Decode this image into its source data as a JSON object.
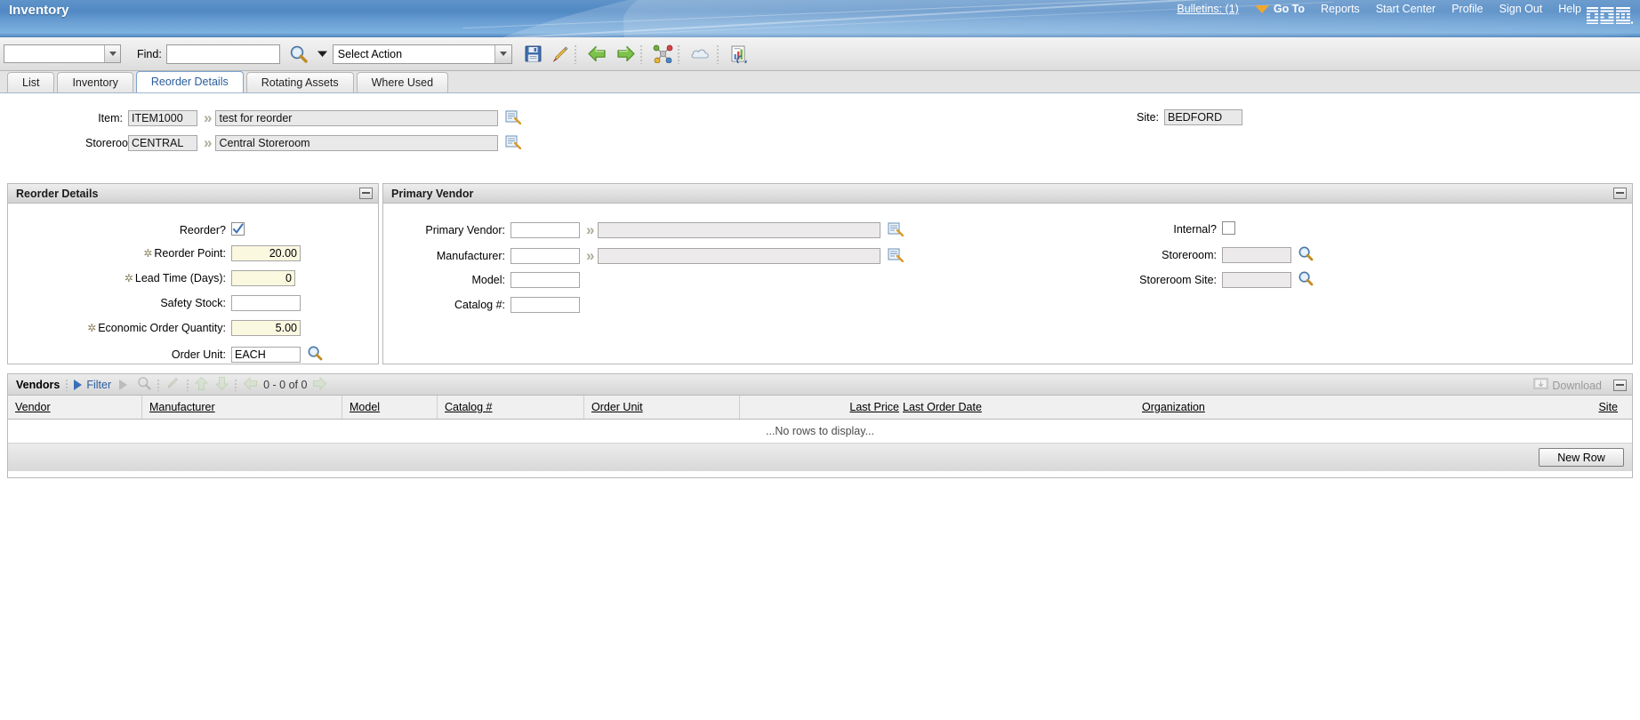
{
  "app": {
    "title": "Inventory"
  },
  "nav": {
    "bulletins": "Bulletins: (1)",
    "goto": "Go To",
    "reports": "Reports",
    "start_center": "Start Center",
    "profile": "Profile",
    "sign_out": "Sign Out",
    "help": "Help",
    "brand": "IBM"
  },
  "toolbar": {
    "search_select_value": "",
    "find_label": "Find:",
    "find_value": "",
    "action_label": "Select Action",
    "icons": [
      "save-icon",
      "clear-changes-icon",
      "previous-record-icon",
      "next-record-icon",
      "workflow-icon",
      "view-history-icon",
      "create-report-icon"
    ]
  },
  "tabs": [
    {
      "label": "List",
      "active": false
    },
    {
      "label": "Inventory",
      "active": false
    },
    {
      "label": "Reorder Details",
      "active": true
    },
    {
      "label": "Rotating Assets",
      "active": false
    },
    {
      "label": "Where Used",
      "active": false
    }
  ],
  "header_form": {
    "item_label": "Item:",
    "item_value": "ITEM1000",
    "item_desc": "test for reorder",
    "storeroom_label": "Storeroom:",
    "storeroom_value": "CENTRAL",
    "storeroom_desc": "Central Storeroom",
    "site_label": "Site:",
    "site_value": "BEDFORD"
  },
  "reorder_details": {
    "title": "Reorder Details",
    "fields": [
      {
        "label": "Reorder?",
        "value": "",
        "type": "checkbox",
        "checked": true,
        "required": false
      },
      {
        "label": "Reorder Point:",
        "value": "20.00",
        "type": "number",
        "required": true
      },
      {
        "label": "Lead Time (Days):",
        "value": "0",
        "type": "number",
        "required": true
      },
      {
        "label": "Safety Stock:",
        "value": "",
        "type": "number",
        "required": false
      },
      {
        "label": "Economic Order Quantity:",
        "value": "5.00",
        "type": "number",
        "required": true
      },
      {
        "label": "Order Unit:",
        "value": "EACH",
        "type": "lookup",
        "required": false
      }
    ]
  },
  "primary_vendor": {
    "title": "Primary Vendor",
    "left_fields": [
      {
        "label": "Primary Vendor:",
        "value": "",
        "desc": "",
        "has_chevron": true,
        "has_detail": true
      },
      {
        "label": "Manufacturer:",
        "value": "",
        "desc": "",
        "has_chevron": true,
        "has_detail": true
      },
      {
        "label": "Model:",
        "value": "",
        "has_chevron": false,
        "has_detail": false
      },
      {
        "label": "Catalog #:",
        "value": "",
        "has_chevron": false,
        "has_detail": false
      }
    ],
    "right_fields": [
      {
        "label": "Internal?",
        "value": "",
        "type": "checkbox",
        "checked": false
      },
      {
        "label": "Storeroom:",
        "value": "",
        "type": "lookup"
      },
      {
        "label": "Storeroom Site:",
        "value": "",
        "type": "lookup"
      }
    ]
  },
  "vendors_table": {
    "title": "Vendors",
    "filter_label": "Filter",
    "count_label": "0 - 0 of 0",
    "download_label": "Download",
    "columns": [
      "Vendor",
      "Manufacturer",
      "Model",
      "Catalog #",
      "Order Unit",
      "Last Price",
      "Last Order Date",
      "Organization",
      "Site"
    ],
    "rows": [],
    "empty_message": "...No rows to display...",
    "new_row_label": "New Row"
  },
  "colors": {
    "banner_blue": "#5f93c9",
    "link_blue": "#2a5d9e",
    "required_field": "#fbf8e0",
    "accent_orange": "#f0a830"
  }
}
